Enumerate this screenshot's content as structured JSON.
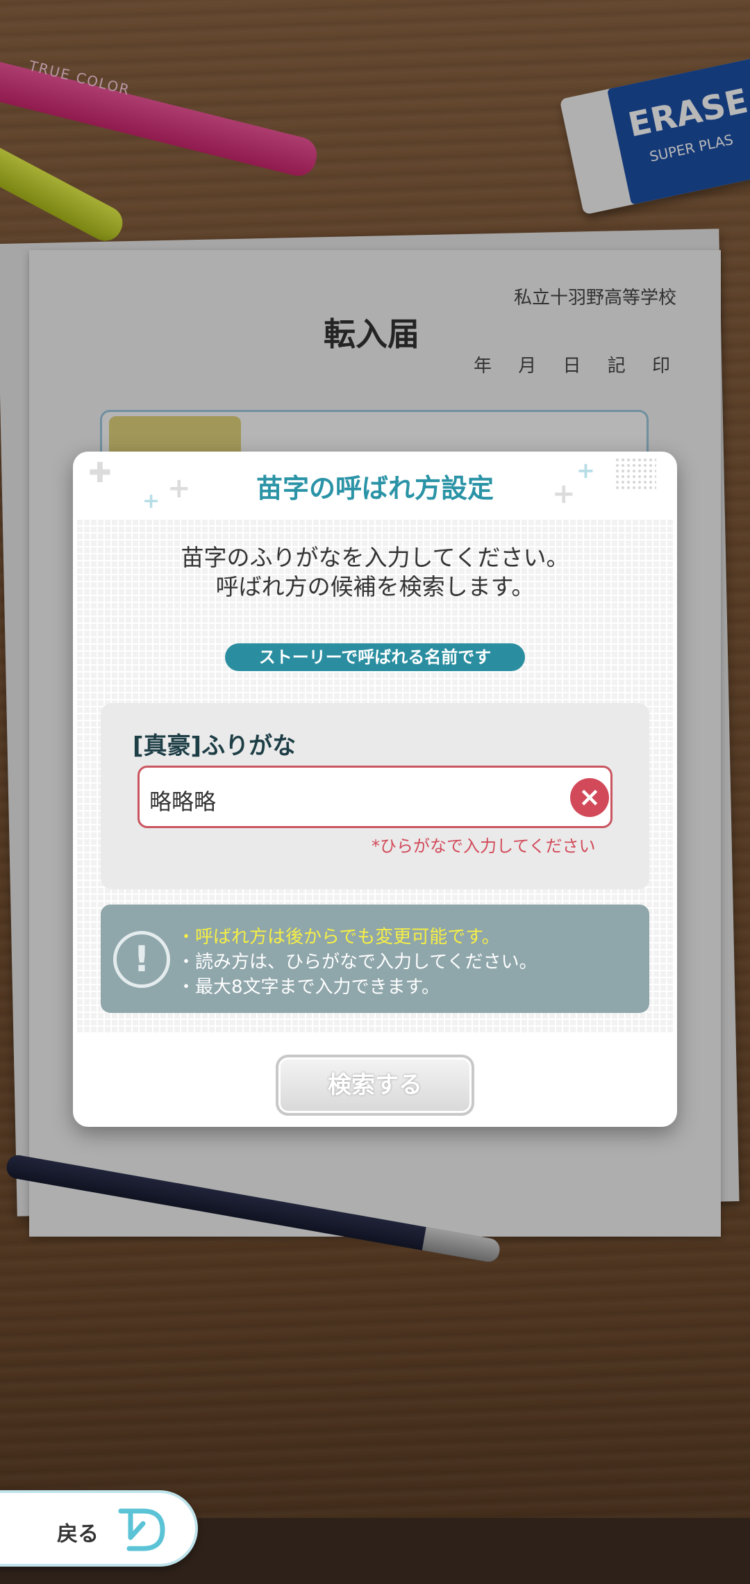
{
  "background": {
    "school_name": "私立十羽野高等学校",
    "form_title": "転入届",
    "date_row": "年 月 日 記 印",
    "eraser_brand": "ERASE",
    "eraser_sub": "SUPER PLAS",
    "marker_text": "TRUE COLOR"
  },
  "dialog": {
    "title": "苗字の呼ばれ方設定",
    "instruction_line1": "苗字のふりがなを入力してください。",
    "instruction_line2": "呼ばれ方の候補を検索します。",
    "pill_label": "ストーリーで呼ばれる名前です",
    "input_label": "[真豪]ふりがな",
    "input_value": "略略略",
    "clear_icon": "×",
    "hint": "*ひらがなで入力してください",
    "notice_icon": "!",
    "notice_lines": [
      "・呼ばれ方は後からでも変更可能です。",
      "・読み方は、ひらがなで入力してください。",
      "・最大8文字まで入力できます。"
    ],
    "search_button": "検索する"
  },
  "footer": {
    "back_label": "戻る"
  },
  "colors": {
    "accent": "#2a93a6",
    "error": "#d24a5a",
    "notice_bg": "#8fa6ab",
    "notice_highlight": "#f6ef45"
  }
}
